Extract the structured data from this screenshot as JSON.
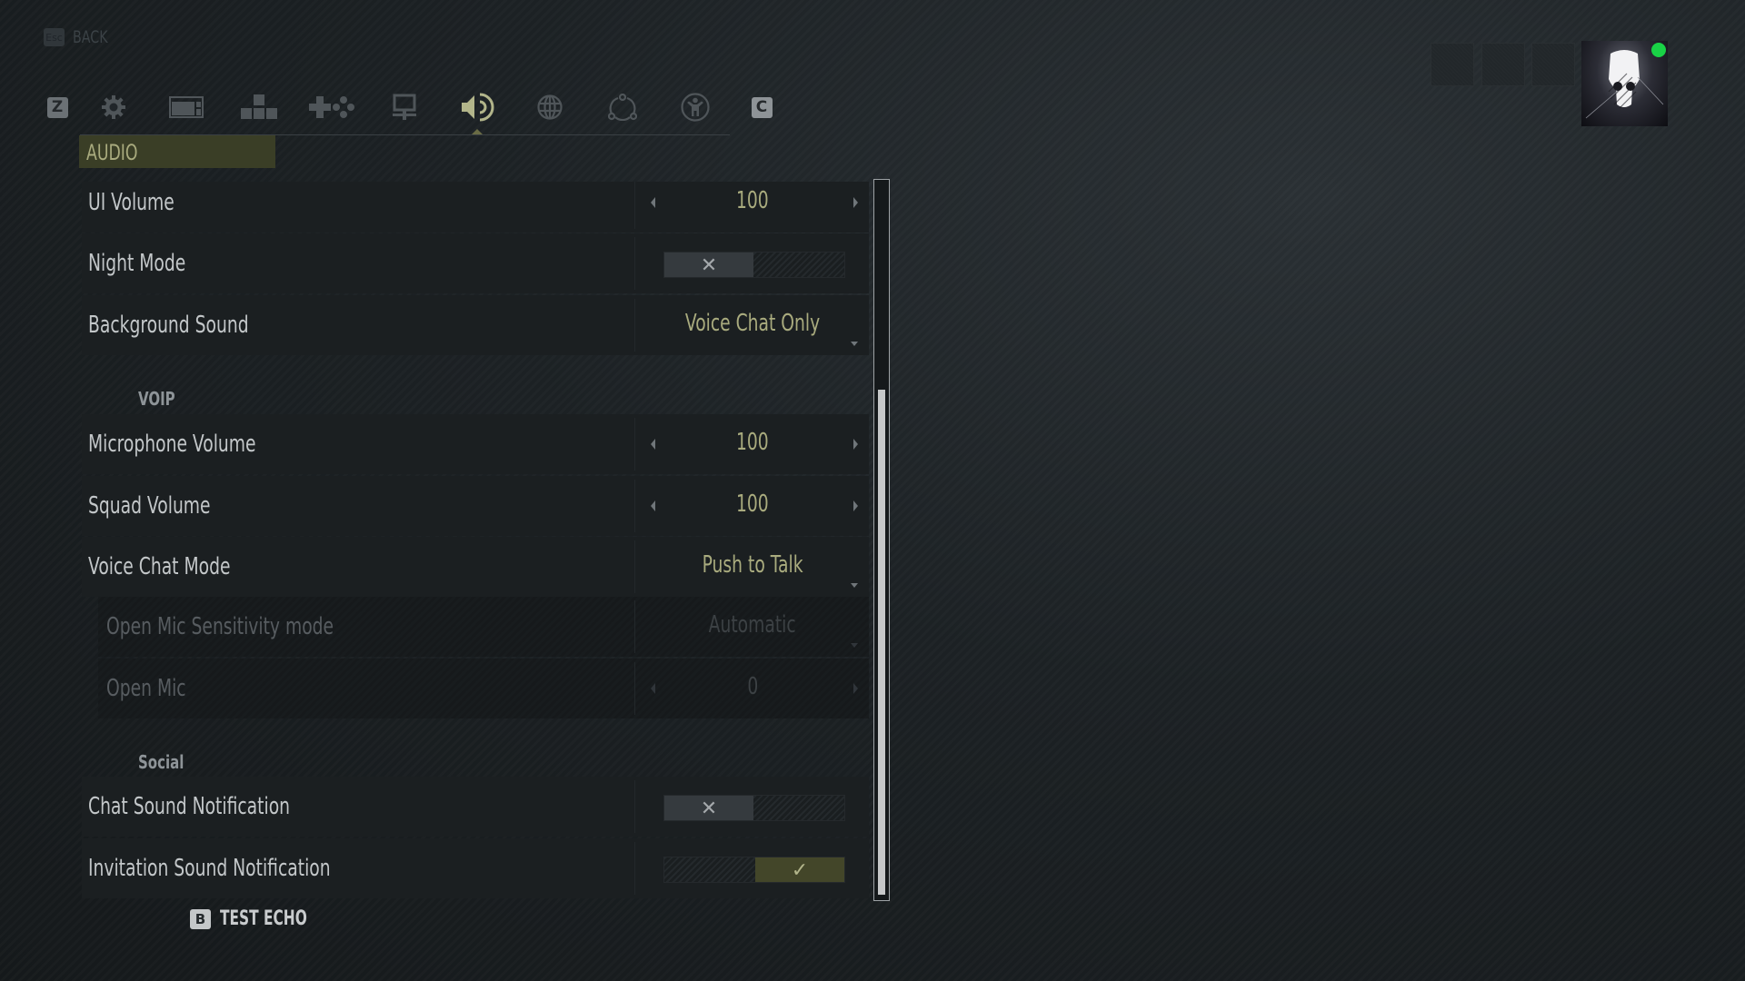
{
  "back": {
    "key": "Esc",
    "label": "BACK"
  },
  "tabs": [
    {
      "id": "prev-key",
      "key": "Z",
      "icon": "z-key-icon"
    },
    {
      "id": "general",
      "icon": "gear-icon"
    },
    {
      "id": "display",
      "icon": "display-window-icon"
    },
    {
      "id": "keyboard",
      "icon": "arrow-keys-icon"
    },
    {
      "id": "controller",
      "icon": "gamepad-icon"
    },
    {
      "id": "interface",
      "icon": "monitor-icon"
    },
    {
      "id": "audio",
      "icon": "speaker-icon",
      "active": true
    },
    {
      "id": "language",
      "icon": "globe-icon"
    },
    {
      "id": "social",
      "icon": "network-icon"
    },
    {
      "id": "accessibility",
      "icon": "accessibility-icon"
    },
    {
      "id": "next-key",
      "key": "C",
      "icon": "c-key-icon"
    }
  ],
  "section_title": "AUDIO",
  "settings": {
    "ui_volume": {
      "label": "UI Volume",
      "value": "100"
    },
    "night_mode": {
      "label": "Night Mode",
      "state": "off",
      "off_glyph": "✕",
      "on_glyph": "✓"
    },
    "background_sound": {
      "label": "Background Sound",
      "value": "Voice Chat Only"
    },
    "voip_title": "VOIP",
    "microphone_volume": {
      "label": "Microphone Volume",
      "value": "100"
    },
    "squad_volume": {
      "label": "Squad Volume",
      "value": "100"
    },
    "voice_chat_mode": {
      "label": "Voice Chat Mode",
      "value": "Push to Talk"
    },
    "open_mic_sensitivity_mode": {
      "label": "Open Mic Sensitivity mode",
      "value": "Automatic",
      "disabled": true
    },
    "open_mic": {
      "label": "Open Mic",
      "value": "0",
      "disabled": true
    },
    "social_title": "Social",
    "chat_sound_notification": {
      "label": "Chat Sound Notification",
      "state": "off",
      "off_glyph": "✕"
    },
    "invitation_sound_notification": {
      "label": "Invitation Sound Notification",
      "state": "on",
      "on_glyph": "✓"
    }
  },
  "scroll": {
    "position_fraction": 0.29,
    "visible_fraction": 0.71
  },
  "footer": {
    "test_echo_key": "B",
    "test_echo_label": "TEST ECHO"
  },
  "profile": {
    "status": "online",
    "status_color": "#19d246"
  },
  "colors": {
    "accent": "#a9ab7e",
    "accent_bg": "#3a3e26",
    "toggle_on": "#434629"
  }
}
